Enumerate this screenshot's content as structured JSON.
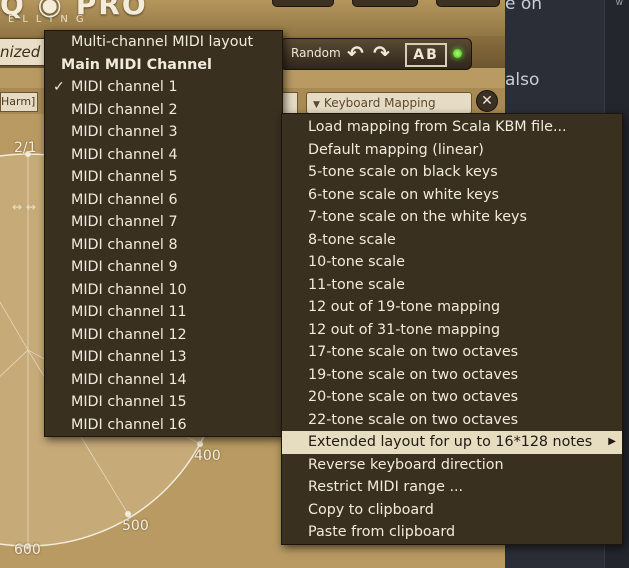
{
  "plugin": {
    "logo_text": "Q ◉ PRO",
    "logo_sub": "ELLING",
    "preset_name": "nized",
    "random_label": "Random",
    "ab_label": "AB",
    "harm_tag": "Harm]",
    "keyboard_mapping_label": "Keyboard Mapping",
    "close_glyph": "✕",
    "undo_glyph": "↶",
    "redo_glyph": "↷",
    "caret_glyph": "▼",
    "arrows_glyph": "↔ ↔"
  },
  "wheel_labels": {
    "ratio": "2/1",
    "l400": "400",
    "l500": "500",
    "l600": "600"
  },
  "right_panel": {
    "text1": "e on",
    "text2": "also",
    "tiny": "w"
  },
  "left_menu": {
    "items": [
      {
        "label": "Multi-channel MIDI layout",
        "type": "item"
      },
      {
        "label": "Main MIDI Channel",
        "type": "header"
      },
      {
        "label": "MIDI channel 1",
        "type": "item",
        "checked": true
      },
      {
        "label": "MIDI channel 2",
        "type": "item"
      },
      {
        "label": "MIDI channel 3",
        "type": "item"
      },
      {
        "label": "MIDI channel 4",
        "type": "item"
      },
      {
        "label": "MIDI channel 5",
        "type": "item"
      },
      {
        "label": "MIDI channel 6",
        "type": "item"
      },
      {
        "label": "MIDI channel 7",
        "type": "item"
      },
      {
        "label": "MIDI channel 8",
        "type": "item"
      },
      {
        "label": "MIDI channel 9",
        "type": "item"
      },
      {
        "label": "MIDI channel 10",
        "type": "item"
      },
      {
        "label": "MIDI channel 11",
        "type": "item"
      },
      {
        "label": "MIDI channel 12",
        "type": "item"
      },
      {
        "label": "MIDI channel 13",
        "type": "item"
      },
      {
        "label": "MIDI channel 14",
        "type": "item"
      },
      {
        "label": "MIDI channel 15",
        "type": "item"
      },
      {
        "label": "MIDI channel 16",
        "type": "item"
      }
    ],
    "check_glyph": "✓"
  },
  "right_menu": {
    "items": [
      {
        "label": "Load mapping from Scala KBM file..."
      },
      {
        "label": "Default mapping (linear)"
      },
      {
        "label": "5-tone scale on black keys"
      },
      {
        "label": "6-tone scale on white keys"
      },
      {
        "label": "7-tone scale on the white keys"
      },
      {
        "label": "8-tone scale"
      },
      {
        "label": "10-tone scale"
      },
      {
        "label": "11-tone scale"
      },
      {
        "label": "12 out of 19-tone mapping"
      },
      {
        "label": "12 out of 31-tone mapping"
      },
      {
        "label": "17-tone scale on two octaves"
      },
      {
        "label": "19-tone scale on two octaves"
      },
      {
        "label": "20-tone scale on two octaves"
      },
      {
        "label": "22-tone scale on two octaves"
      },
      {
        "label": "Extended layout for up to 16*128 notes",
        "highlighted": true,
        "submenu": true
      },
      {
        "label": "Reverse keyboard direction"
      },
      {
        "label": "Restrict MIDI range ..."
      },
      {
        "label": "Copy to clipboard"
      },
      {
        "label": "Paste from clipboard"
      }
    ],
    "submenu_glyph": "▶"
  },
  "colors": {
    "menu_bg": "#3a3020",
    "menu_text": "#f1ebdd",
    "highlight_bg": "#e6dcc0",
    "gold": "#b89a62"
  }
}
